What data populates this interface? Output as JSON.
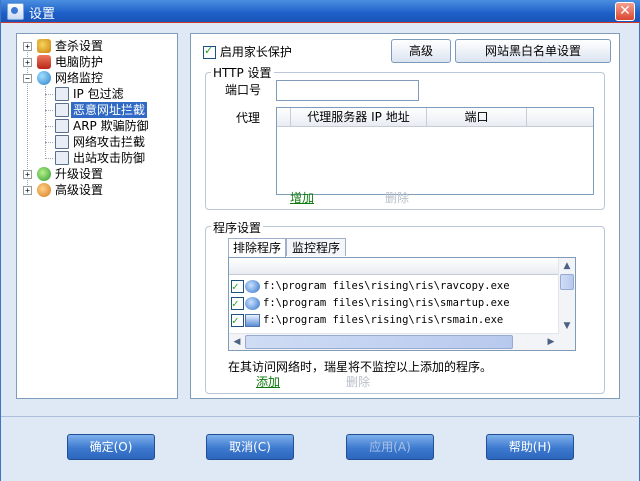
{
  "window": {
    "title": "设置"
  },
  "tree": {
    "items": [
      {
        "label": "查杀设置",
        "icon": "search-shield-icon"
      },
      {
        "label": "电脑防护",
        "icon": "shield-icon"
      },
      {
        "label": "网络监控",
        "icon": "globe-icon"
      },
      {
        "label": "IP 包过滤",
        "icon": "filter-icon"
      },
      {
        "label": "恶意网址拦截",
        "icon": "url-block-icon"
      },
      {
        "label": "ARP 欺骗防御",
        "icon": "arp-icon"
      },
      {
        "label": "网络攻击拦截",
        "icon": "network-attack-icon"
      },
      {
        "label": "出站攻击防御",
        "icon": "outbound-icon"
      },
      {
        "label": "升级设置",
        "icon": "upgrade-icon"
      },
      {
        "label": "高级设置",
        "icon": "advanced-gear-icon"
      }
    ],
    "selected": "恶意网址拦截"
  },
  "panel": {
    "parental_checkbox_label": "启用家长保护",
    "advanced_button": "高级",
    "blacklist_button": "网站黑白名单设置",
    "http": {
      "group_title": "HTTP 设置",
      "port_label": "端口号",
      "port_value": "",
      "proxy_label": "代理",
      "columns": [
        "代理服务器 IP 地址",
        "端口"
      ],
      "add_link": "增加",
      "delete_link": "删除"
    },
    "program": {
      "group_title": "程序设置",
      "tabs": [
        "排除程序",
        "监控程序"
      ],
      "rows": [
        {
          "checked": true,
          "path": "f:\\program files\\rising\\ris\\ravcopy.exe"
        },
        {
          "checked": true,
          "path": "f:\\program files\\rising\\ris\\smartup.exe"
        },
        {
          "checked": true,
          "path": "f:\\program files\\rising\\ris\\rsmain.exe"
        }
      ],
      "hint": "在其访问网络时，瑞星将不监控以上添加的程序。",
      "add_link": "添加",
      "delete_link": "删除"
    }
  },
  "buttons": {
    "ok": "确定(O)",
    "cancel": "取消(C)",
    "apply": "应用(A)",
    "help": "帮助(H)"
  },
  "colors": {
    "title_bar": "#1d5fc8",
    "selection": "#316ac5",
    "link_enabled": "#0f7a0f",
    "link_disabled": "#b7bfc9"
  }
}
